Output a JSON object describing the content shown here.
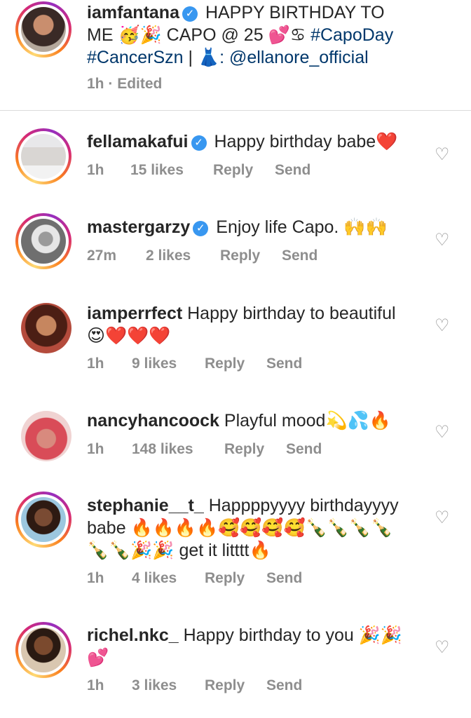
{
  "post": {
    "username": "iamfantana",
    "caption_1": "HAPPY BIRTHDAY TO",
    "caption_2a": "ME",
    "caption_2_emoji": "🥳🎉",
    "caption_2b": "CAPO @ 25",
    "caption_2_emoji2": "💕♋",
    "caption_2_tag": "#CapoDay",
    "caption_3_tag": "#CancerSzn",
    "caption_3_sep": "|",
    "caption_3_emoji": "👗",
    "caption_3_mention": ": @ellanore_official",
    "time": "1h",
    "sep": "·",
    "edited": "Edited"
  },
  "comments": [
    {
      "username": "fellamakafui",
      "verified": true,
      "text": "Happy birthday babe",
      "emoji": "❤️",
      "time": "1h",
      "likes": "15 likes",
      "reply": "Reply",
      "send": "Send"
    },
    {
      "username": "mastergarzy",
      "verified": true,
      "text": "Enjoy life Capo.",
      "emoji": "🙌🙌",
      "time": "27m",
      "likes": "2 likes",
      "reply": "Reply",
      "send": "Send"
    },
    {
      "username": "iamperrfect",
      "verified": false,
      "text": "Happy birthday to beautiful",
      "emoji": "😍❤️❤️❤️",
      "time": "1h",
      "likes": "9 likes",
      "reply": "Reply",
      "send": "Send"
    },
    {
      "username": "nancyhancoock",
      "verified": false,
      "text": "Playful mood",
      "emoji": "💫💦🔥",
      "time": "1h",
      "likes": "148 likes",
      "reply": "Reply",
      "send": "Send"
    },
    {
      "username": "stephanie__t_",
      "verified": false,
      "text": "Happppyyyy birthdayyyy",
      "text2": "babe",
      "emoji": "🔥🔥🔥🔥🥰🥰🥰🥰🍾🍾🍾🍾",
      "emoji2": "🍾🍾🎉🎉",
      "text3": "get it litttt",
      "emoji3": "🔥",
      "time": "1h",
      "likes": "4 likes",
      "reply": "Reply",
      "send": "Send"
    },
    {
      "username": "richel.nkc_",
      "verified": false,
      "text": "Happy birthday to you",
      "emoji": "🎉🎉",
      "emoji2": "💕",
      "time": "1h",
      "likes": "3 likes",
      "reply": "Reply",
      "send": "Send"
    }
  ],
  "icons": {
    "like": "heart-outline-icon",
    "verified": "verified-badge-icon"
  },
  "colors": {
    "text": "#262626",
    "meta": "#8e8e8e",
    "link": "#00376b",
    "verified": "#3897f0"
  }
}
